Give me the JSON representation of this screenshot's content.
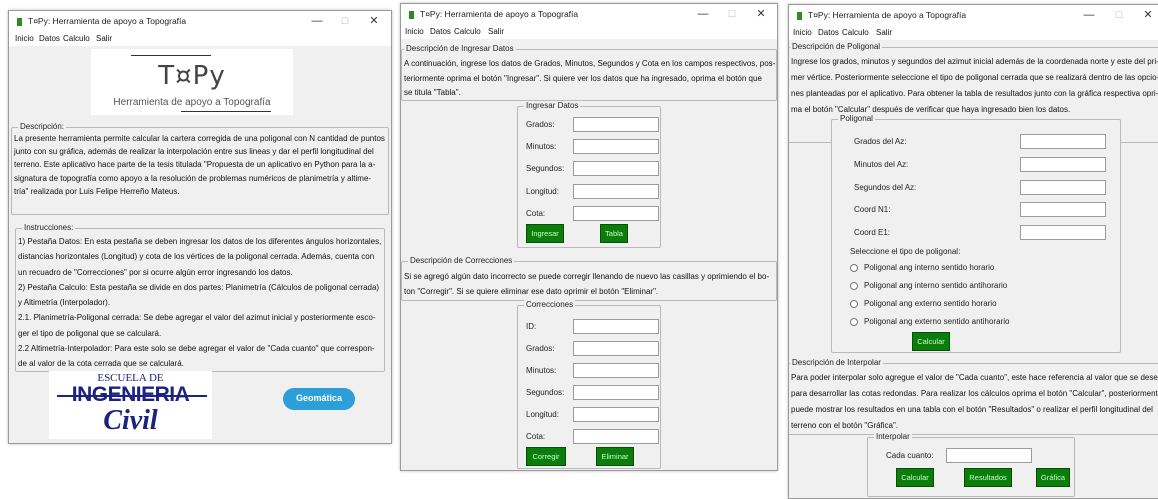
{
  "window_title": "T¤Py: Herramienta de apoyo a Topografía",
  "window_controls": {
    "minimize": "—",
    "maximize": "☐",
    "close": "✕"
  },
  "menu": [
    "Inicio",
    "Datos",
    "Calculo",
    "Salir"
  ],
  "colors": {
    "button_green": "#0b7d0b",
    "button_text": "#c8ffc8",
    "window_bg": "#f0f0f0",
    "civil_blue": "#1a237e",
    "geomatica_blue": "#2c9fdb"
  },
  "win1": {
    "logo": {
      "title": "T¤Py",
      "subtitle": "Herramienta de apoyo a Topografía"
    },
    "descripcion_title": "Descripción:",
    "descripcion_lines": [
      "La presente herramienta permite calcular la cartera corregida de una poligonal con N cantidad de puntos",
      "junto con su gráfica, además de realizar la interpolación entre sus lineas y dar el perfil longitudinal del",
      "terreno. Este aplicativo hace parte de la tesis titulada \"Propuesta de un aplicativo en Python para la a-",
      "signatura de topografía como apoyo a la resolución de problemas numéricos de planimetría y altime-",
      "tría\" realizada por Luis Felipe Herreño Mateus."
    ],
    "instrucciones_title": "Instrucciones:",
    "instrucciones_lines": [
      "1) Pestaña Datos: En esta pestaña se deben ingresar los datos de los diferentes ángulos horizontales,",
      "distancias horizontales (Longitud) y cota de los vértices de la poligonal cerrada. Además, cuenta con",
      "un recuadro de \"Correcciones\" por si ocurre algún error ingresando los datos.",
      "2) Pestaña Calculo: Esta pestaña se divide en dos partes: Planimetría (Cálculos de poligonal cerrada)",
      "y Altimetría (Interpolador).",
      "2.1. Planimetría-Poligonal cerrada: Se debe agregar el valor del azimut inicial y posteriormente esco-",
      "ger el tipo de poligonal que se calculará.",
      "2.2 Altimetría-Interpolador: Para este solo se debe agregar el valor de \"Cada cuanto\" que correspon-",
      "de al valor de la cota cerrada que se calculará."
    ],
    "logo_escuela": {
      "line1": "ESCUELA DE",
      "line2": "INGENIERIA",
      "line3": "Civil"
    },
    "logo_geomatica": "Geomática"
  },
  "win2": {
    "desc_title": "Descripción de Ingresar Datos",
    "desc_lines": [
      "A continuación, ingrese los datos de Grados, Minutos, Segundos y Cota en los campos respectivos, pos-",
      "teriormente oprima el botón \"Ingresar\". Si quiere ver los datos que ha ingresado, oprima el botón que",
      "se titula \"Tabla\"."
    ],
    "ingresar_title": "Ingresar Datos",
    "ingresar_fields": [
      "Grados:",
      "Minutos:",
      "Segundos:",
      "Longitud:",
      "Cota:"
    ],
    "btn_ingresar": "Ingresar",
    "btn_tabla": "Tabla",
    "corr_desc_title": "Descripción de Correcciones",
    "corr_desc_lines": [
      "Si se agregó algún dato incorrecto se puede corregir llenando de nuevo las casillas y oprimiendo el bo-",
      "ton \"Corregir\". Si se quiere eliminar ese dato oprimir el botón \"Eliminar\"."
    ],
    "corr_title": "Correcciones",
    "corr_fields": [
      "ID:",
      "Grados:",
      "Minutos:",
      "Segundos:",
      "Longitud:",
      "Cota:"
    ],
    "btn_corregir": "Corregir",
    "btn_eliminar": "Eliminar"
  },
  "win3": {
    "desc_title": "Descripción de Poligonal",
    "desc_lines": [
      "Ingrese los grados, minutos y segundos del azimut inicial además de la coordenada norte y este del pri-",
      "mer vértice. Posteriormente seleccione el tipo de poligonal cerrada que se realizará dentro de las opcio-",
      "nes planteadas por el aplicativo. Para obtener la tabla de resultados junto con la gráfica respectiva opri-",
      "ma el botón \"Calcular\" después de verificar que haya ingresado bien los datos."
    ],
    "poligonal_title": "Poligonal",
    "poligonal_fields": [
      "Grados del Az:",
      "Minutos del Az:",
      "Segundos del Az:",
      "Coord N1:",
      "Coord E1:"
    ],
    "tipo_label": "Seleccione el tipo de poligonal:",
    "radio_options": [
      "Poligonal ang interno sentido horario",
      "Poligonal ang interno sentido antihorario",
      "Poligonal ang externo sentido horario",
      "Poligonal ang externo sentido antihorario"
    ],
    "btn_calcular": "Calcular",
    "interp_desc_title": "Descripción de Interpolar",
    "interp_desc_lines": [
      "Para poder interpolar solo agregue el valor de \"Cada cuanto\", este hace referencia al valor que se desea",
      "para desarrollar las cotas redondas. Para realizar los cálculos oprima el botón \"Calcular\", posteriormente",
      "puede mostrar los resultados en una tabla con el botón \"Resultados\" o realizar el perfil longitudinal del",
      "terreno con el botón \"Gráfica\"."
    ],
    "interpolar_title": "Interpolar",
    "cada_cuanto_label": "Cada cuanto:",
    "btn_calcular2": "Calcular",
    "btn_resultados": "Resultados",
    "btn_grafica": "Gráfica"
  }
}
